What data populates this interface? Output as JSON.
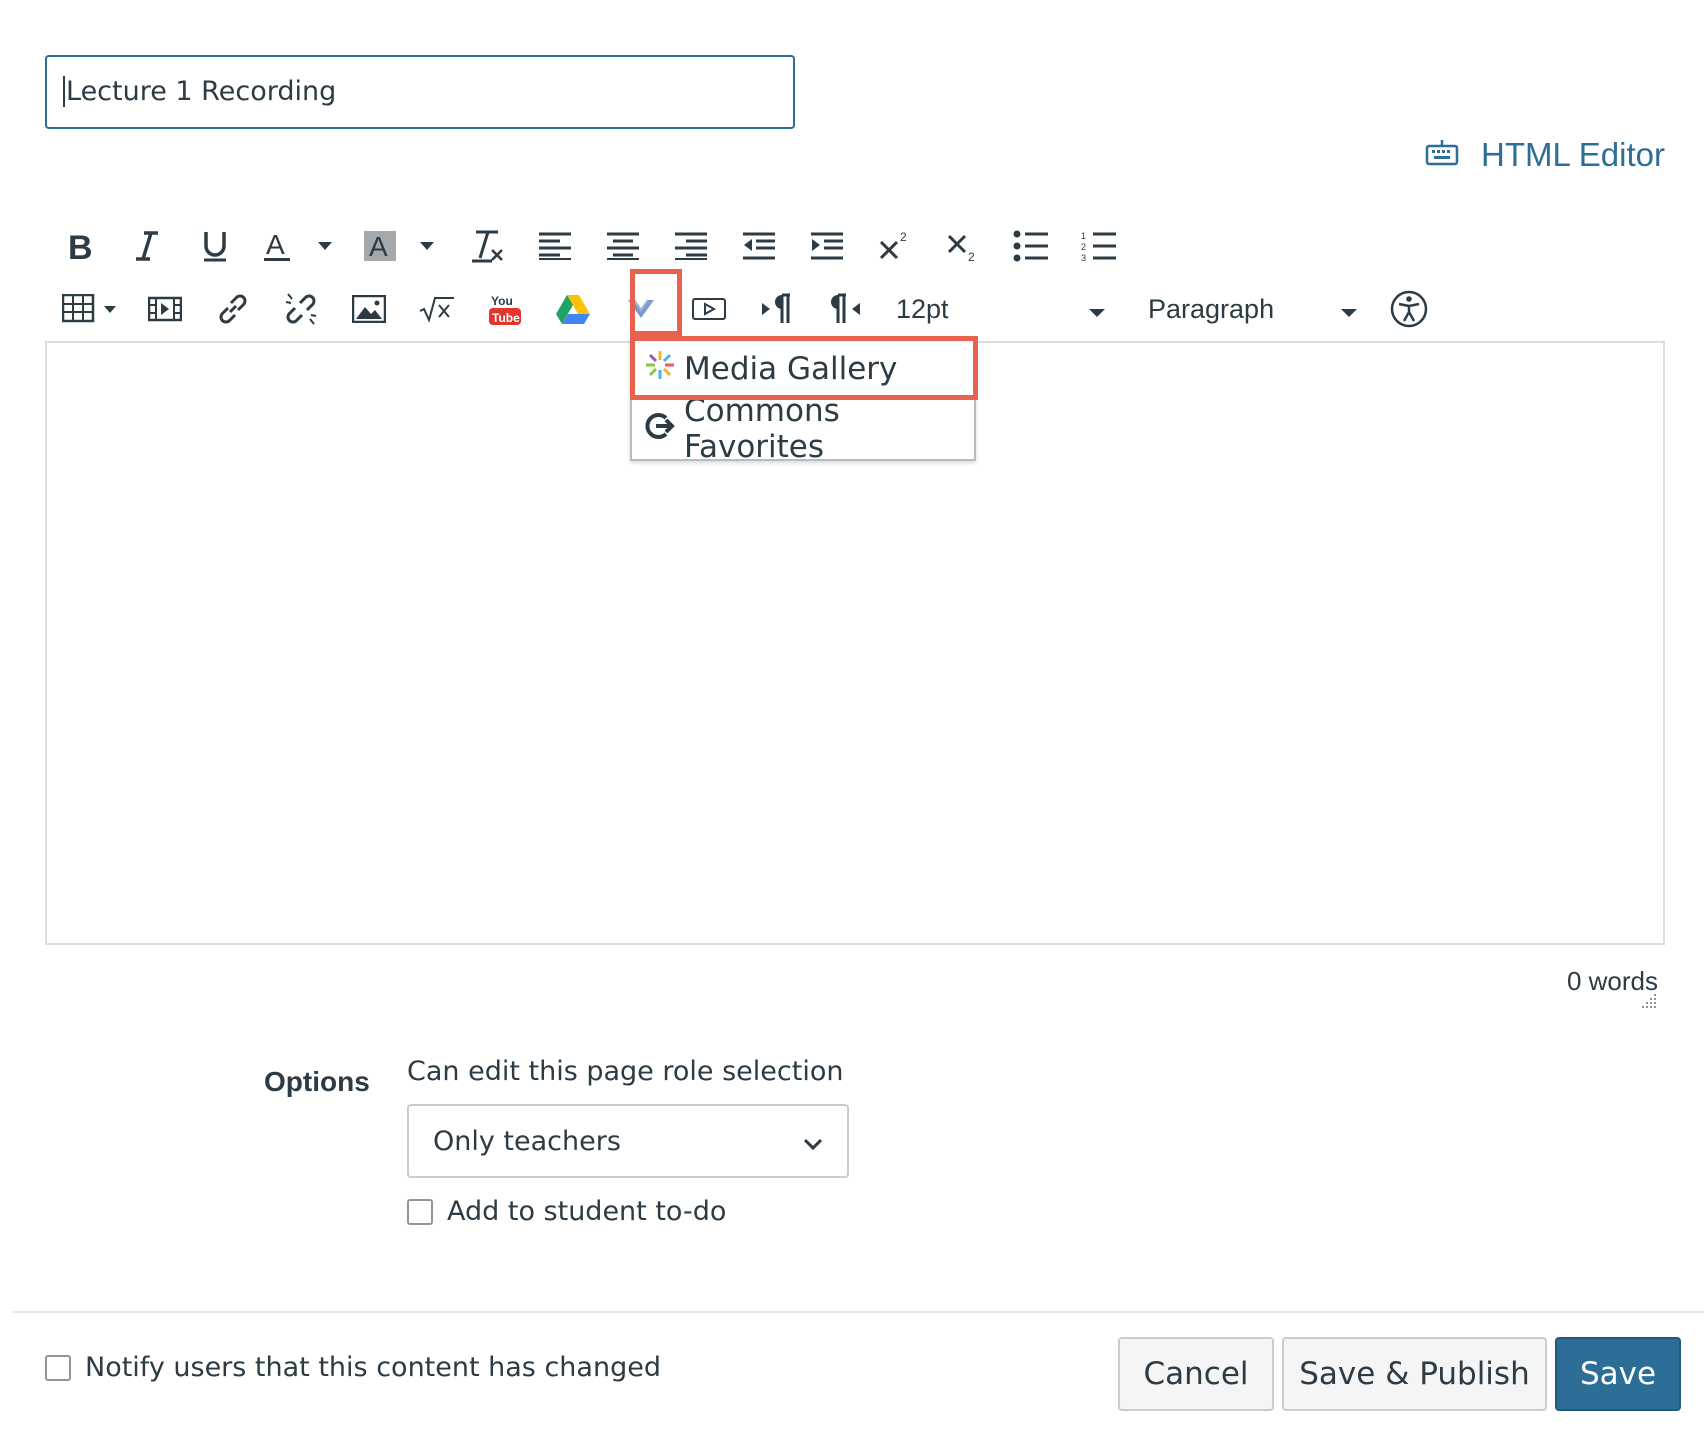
{
  "page": {
    "title_value": "Lecture 1 Recording",
    "html_editor_label": "HTML Editor",
    "accent_color": "#2d6e96",
    "highlight_color": "#e8614e"
  },
  "toolbar": {
    "row1_icons": [
      "bold-icon",
      "italic-icon",
      "underline-icon",
      "text-color-icon",
      "background-color-icon",
      "clear-formatting-icon",
      "align-left-icon",
      "align-center-icon",
      "align-right-icon",
      "outdent-icon",
      "indent-icon",
      "superscript-icon",
      "subscript-icon",
      "bullet-list-icon",
      "numbered-list-icon"
    ],
    "font_size": "12pt",
    "block_format": "Paragraph"
  },
  "media_menu": {
    "items": [
      {
        "label": "Media Gallery",
        "icon": "kaltura-sparkle-icon"
      },
      {
        "label": "Commons Favorites",
        "icon": "commons-share-icon"
      }
    ]
  },
  "editor": {
    "word_count": "0 words"
  },
  "options": {
    "label": "Options",
    "role_label": "Can edit this page role selection",
    "role_value": "Only teachers",
    "todo_label": "Add to student to-do"
  },
  "footer": {
    "notify_label": "Notify users that this content has changed",
    "cancel_label": "Cancel",
    "save_publish_label": "Save & Publish",
    "save_label": "Save"
  }
}
